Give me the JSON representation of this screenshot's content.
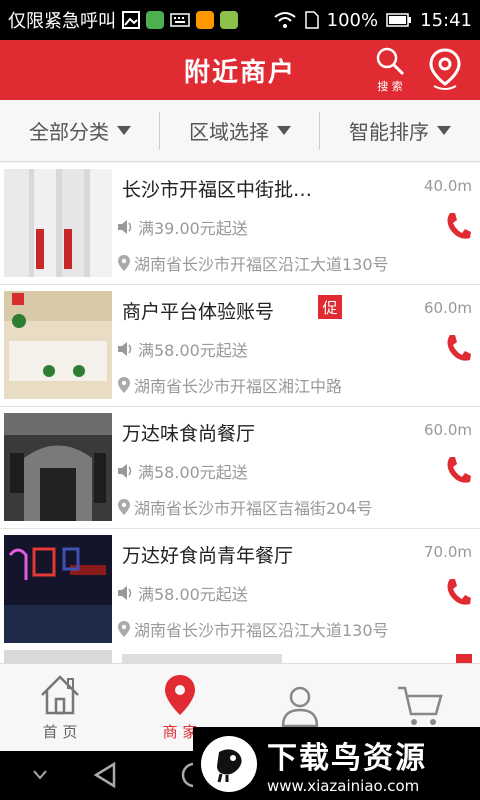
{
  "status_bar": {
    "left_text": "仅限紧急呼叫",
    "battery": "100%",
    "time": "15:41"
  },
  "header": {
    "title": "附近商户",
    "search_label": "搜 索"
  },
  "filters": [
    {
      "label": "全部分类"
    },
    {
      "label": "区域选择"
    },
    {
      "label": "智能排序"
    }
  ],
  "merchants": [
    {
      "name": "长沙市开福区中街批…",
      "distance": "40.0m",
      "min_order": "满39.00元起送",
      "address": "湖南省长沙市开福区沿江大道130号",
      "promo": ""
    },
    {
      "name": "商户平台体验账号",
      "distance": "60.0m",
      "min_order": "满58.00元起送",
      "address": "湖南省长沙市开福区湘江中路",
      "promo": "促"
    },
    {
      "name": "万达味食尚餐厅",
      "distance": "60.0m",
      "min_order": "满58.00元起送",
      "address": "湖南省长沙市开福区吉福街204号",
      "promo": ""
    },
    {
      "name": "万达好食尚青年餐厅",
      "distance": "70.0m",
      "min_order": "满58.00元起送",
      "address": "湖南省长沙市开福区沿江大道130号",
      "promo": ""
    }
  ],
  "tabs": [
    {
      "label": "首 页"
    },
    {
      "label": "商 家"
    },
    {
      "label": ""
    },
    {
      "label": ""
    }
  ],
  "watermark": {
    "title": "下载鸟资源",
    "url": "www.xiazainiao.com"
  },
  "colors": {
    "brand": "#e02b33",
    "muted": "#999999"
  }
}
